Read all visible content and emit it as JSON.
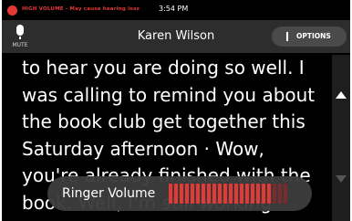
{
  "status_bar": {
    "warning_text": "HIGH VOLUME - May cause hearing loss",
    "time": "3:54 PM",
    "warning_color": "#e53935"
  },
  "header": {
    "mute_label": "MUTE",
    "mute_icon": "microphone-icon",
    "caller_name": "Karen Wilson",
    "options_label": "OPTIONS"
  },
  "captions": {
    "lines": [
      "to hear you are doing so well. I",
      "was calling to remind you about",
      "the book club get together this",
      "Saturday afternoon · Wow,",
      "you're already finished with the",
      "book. Well, I'm still working"
    ]
  },
  "volume_toast": {
    "label": "Ringer Volume",
    "level_fraction": 0.85,
    "bar_color": "#e53935"
  },
  "scroll": {
    "up_icon": "chevron-up-icon",
    "down_icon": "chevron-down-icon"
  }
}
